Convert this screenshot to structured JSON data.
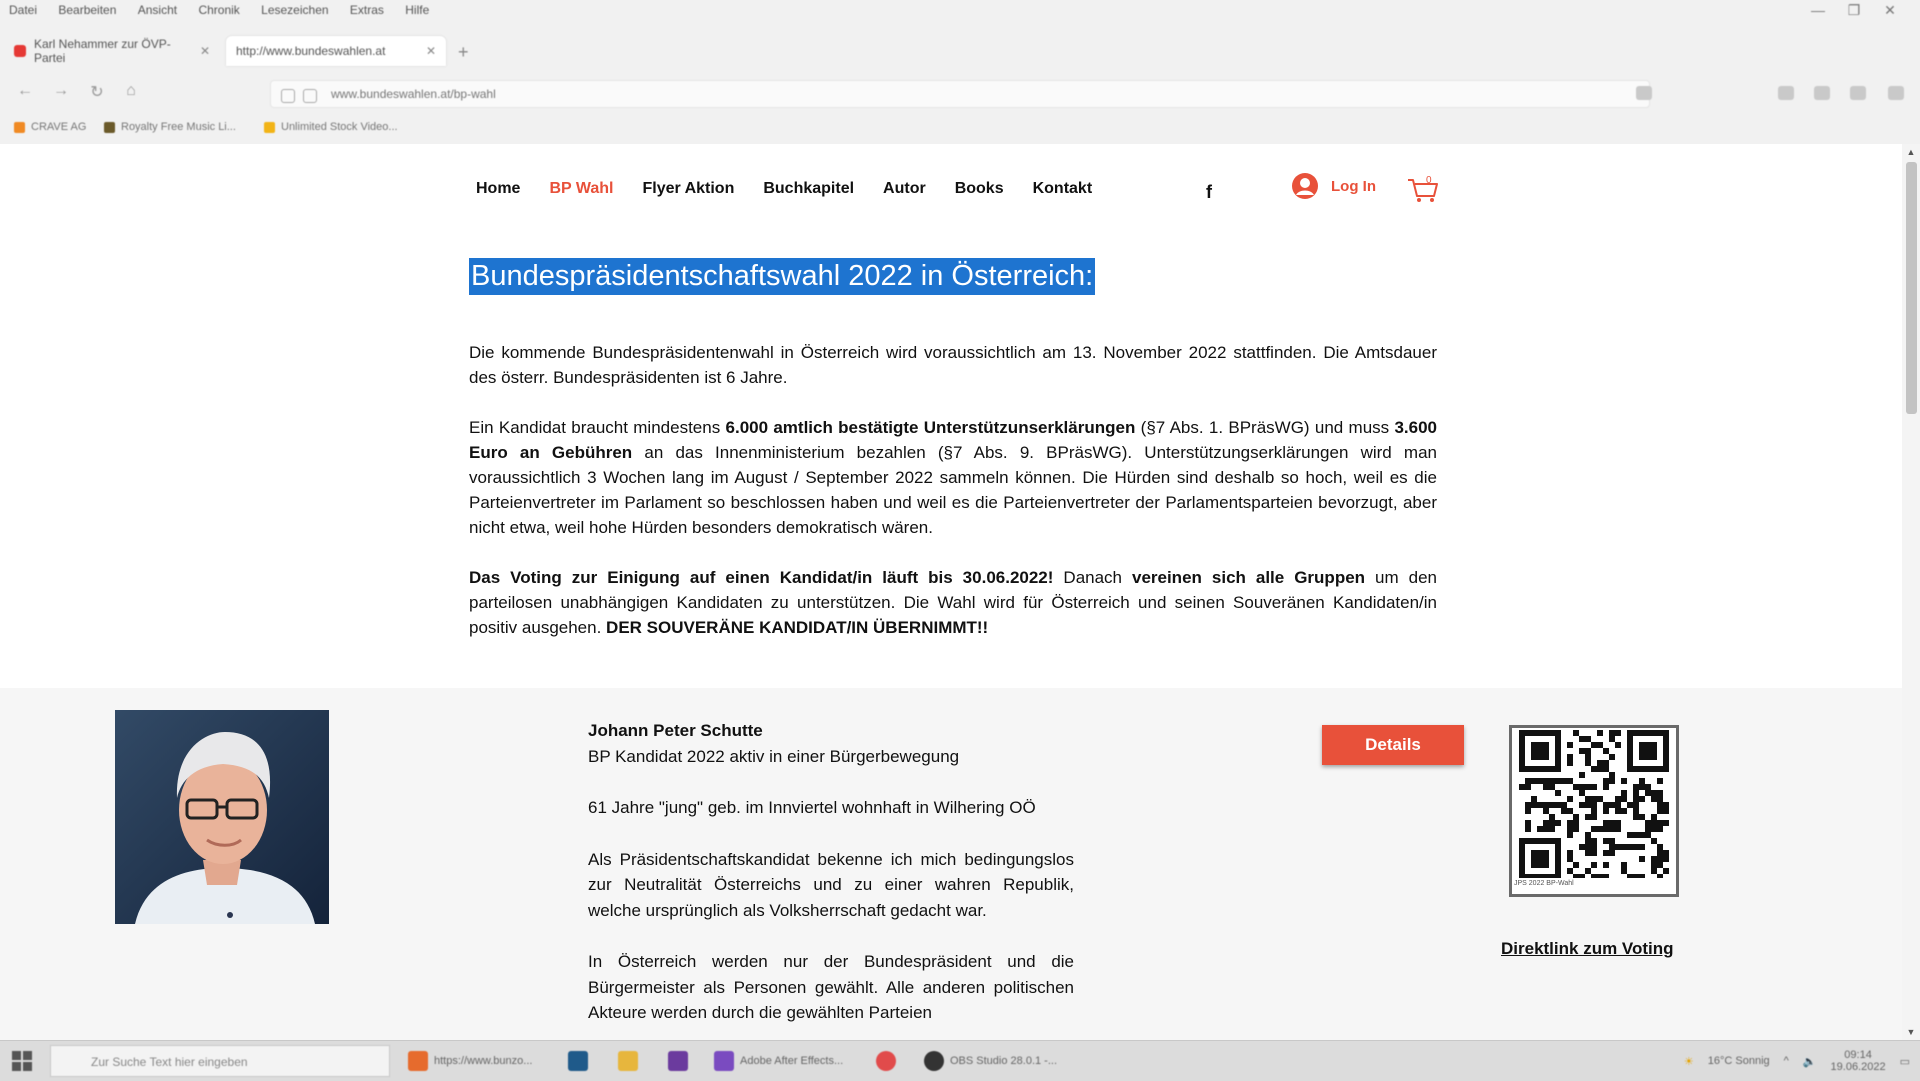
{
  "browser": {
    "menu": [
      "Datei",
      "Bearbeiten",
      "Ansicht",
      "Chronik",
      "Lesezeichen",
      "Extras",
      "Hilfe"
    ],
    "tabs": [
      {
        "label": "Karl Nehammer zur ÖVP-Partei",
        "active": false
      },
      {
        "label": "http://www.bundeswahlen.at",
        "active": true
      }
    ],
    "url": "www.bundeswahlen.at/bp-wahl",
    "bookmarks": [
      "CRAVE AG",
      "Royalty Free Music Li...",
      "Unlimited Stock Video..."
    ]
  },
  "site": {
    "nav": [
      "Home",
      "BP Wahl",
      "Flyer Aktion",
      "Buchkapitel",
      "Autor",
      "Books",
      "Kontakt"
    ],
    "current_nav": "BP Wahl",
    "facebook_glyph": "f",
    "login_label": "Log In",
    "cart_count": "0",
    "accent_color": "#e8513a",
    "selection_color": "#1e74d0"
  },
  "article": {
    "title": "Bundespräsidentschaftswahl 2022 in Österreich:",
    "p1": "Die kommende Bundespräsidentenwahl in Österreich wird voraussichtlich am 13. November 2022 stattfinden. Die Amtsdauer des österr. Bundespräsidenten ist 6 Jahre.",
    "p2a": "Ein Kandidat braucht mindestens ",
    "p2b": "6.000 amtlich bestätigte Unterstützunserklärungen",
    "p2c": " (§7 Abs. 1. BPräsWG) und muss ",
    "p2d": "3.600 Euro an Gebühren",
    "p2e": " an das Innenministerium bezahlen (§7 Abs. 9. BPräsWG). Unterstützungserklärungen wird man voraussichtlich 3 Wochen lang im August / September 2022 sammeln können. Die Hürden sind deshalb so hoch, weil es die Parteienvertreter im Parlament so beschlossen haben und weil es die Parteienvertreter der Parlamentsparteien bevorzugt, aber nicht etwa, weil hohe Hürden besonders demokratisch wären.",
    "p3a": "Das Voting zur Einigung auf einen Kandidat/in läuft bis 30.06.2022!",
    "p3b": " Danach ",
    "p3c": "vereinen sich alle Gruppen",
    "p3d": " um den parteilosen unabhängigen Kandidaten zu unterstützen. Die Wahl wird für Österreich und seinen Souveränen Kandidaten/in positiv ausgehen. ",
    "p3e": "DER SOUVERÄNE KANDIDAT/IN ÜBERNIMMT!!"
  },
  "candidate": {
    "name": "Johann Peter Schutte",
    "subtitle": "BP Kandidat 2022 aktiv in einer Bürgerbewegung",
    "age_line": "61 Jahre \"jung\" geb. im Innviertel wohnhaft in Wilhering OÖ",
    "para1": "Als Präsidentschaftskandidat bekenne ich mich bedingungslos zur Neutralität Österreichs und zu einer wahren Republik, welche ursprünglich als Volksherrschaft gedacht war.",
    "para2": "In Österreich werden nur der Bundespräsident und die Bürgermeister als Personen gewählt. Alle anderen politischen Akteure werden durch die gewählten Parteien",
    "details_button": "Details",
    "qr_caption": "JPS 2022  BP-Wahl",
    "vote_link": "Direktlink zum Voting"
  },
  "taskbar": {
    "search_placeholder": "Zur Suche Text hier eingeben",
    "apps": [
      "https://www.bunzo...",
      "Adobe After Effects...",
      "OBS Studio 28.0.1 -..."
    ],
    "weather": "16°C  Sonnig",
    "time": "09:14",
    "date": "19.06.2022"
  }
}
